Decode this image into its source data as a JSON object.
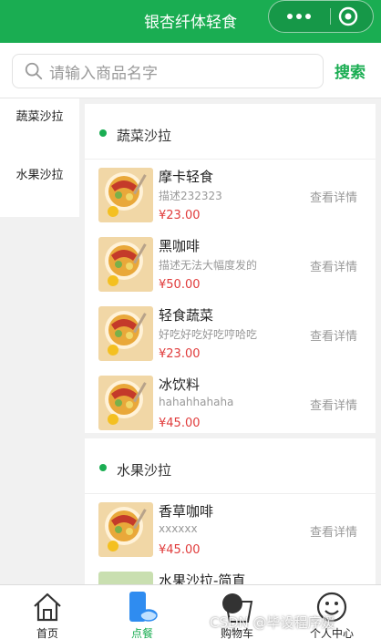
{
  "app": {
    "title": "银杏纤体轻食"
  },
  "search": {
    "placeholder": "请输入商品名字",
    "button_label": "搜索"
  },
  "categories": [
    {
      "label": "蔬菜沙拉"
    },
    {
      "label": "水果沙拉"
    }
  ],
  "sections": [
    {
      "title": "蔬菜沙拉",
      "products": [
        {
          "name": "摩卡轻食",
          "desc": "描述232323",
          "price": "¥23.00",
          "detail": "查看详情"
        },
        {
          "name": "黑咖啡",
          "desc": "描述无法大幅度发的",
          "price": "¥50.00",
          "detail": "查看详情"
        },
        {
          "name": "轻食蔬菜",
          "desc": "好吃好吃好吃哼哈吃",
          "price": "¥23.00",
          "detail": "查看详情"
        },
        {
          "name": "冰饮料",
          "desc": "hahahhahaha",
          "price": "¥45.00",
          "detail": "查看详情"
        }
      ]
    },
    {
      "title": "水果沙拉",
      "products": [
        {
          "name": "香草咖啡",
          "desc": "xxxxxx",
          "price": "¥45.00",
          "detail": "查看详情"
        },
        {
          "name": "水果沙拉-简直",
          "desc": "",
          "price": "",
          "detail": ""
        }
      ]
    }
  ],
  "tabbar": [
    {
      "label": "首页",
      "icon": "home-icon"
    },
    {
      "label": "点餐",
      "icon": "order-icon",
      "active": true
    },
    {
      "label": "购物车",
      "icon": "cart-icon"
    },
    {
      "label": "个人中心",
      "icon": "profile-icon"
    }
  ],
  "watermark": "CSDN @毕设程序媛",
  "colors": {
    "brand": "#1aad52",
    "price": "#e03b3b",
    "muted": "#999999"
  }
}
